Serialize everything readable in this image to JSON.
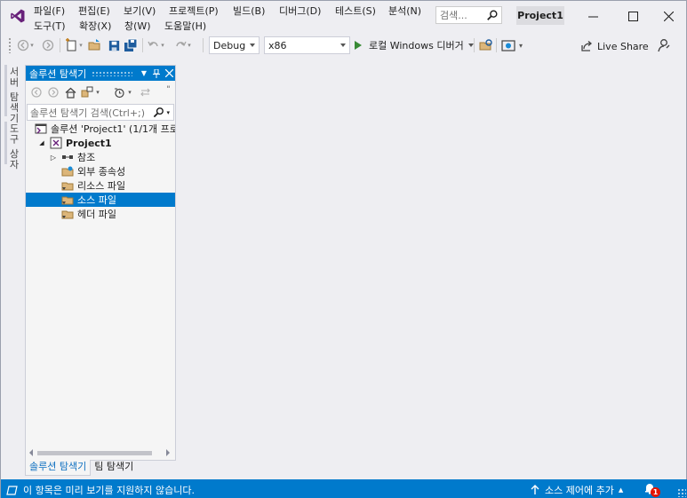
{
  "window": {
    "title": "Project1",
    "search_placeholder": "검색...",
    "controls": {
      "minimize": "—",
      "maximize": "☐",
      "close": "✕"
    }
  },
  "menu": {
    "row1": [
      "파일(F)",
      "편집(E)",
      "보기(V)",
      "프로젝트(P)",
      "빌드(B)",
      "디버그(D)",
      "테스트(S)",
      "분석(N)"
    ],
    "row2": [
      "도구(T)",
      "확장(X)",
      "창(W)",
      "도움말(H)"
    ]
  },
  "toolbar": {
    "config": "Debug",
    "platform": "x86",
    "run_label": "로컬 Windows 디버거",
    "live_share": "Live Share"
  },
  "side_tabs": [
    "서버 탐색기",
    "도구 상자"
  ],
  "solution_explorer": {
    "title": "솔루션 탐색기",
    "search_placeholder": "솔루션 탐색기 검색(Ctrl+;)",
    "tree": [
      {
        "label": "솔루션 'Project1' (1/1개 프로젝트)",
        "level": 0,
        "expander": "",
        "icon": "solution-icon",
        "bold": false,
        "selected": false
      },
      {
        "label": "Project1",
        "level": 1,
        "expander": "◢",
        "icon": "project-icon",
        "bold": true,
        "selected": false
      },
      {
        "label": "참조",
        "level": 2,
        "expander": "▷",
        "icon": "references-icon",
        "bold": false,
        "selected": false
      },
      {
        "label": "외부 종속성",
        "level": 2,
        "expander": "",
        "icon": "external-deps-icon",
        "bold": false,
        "selected": false
      },
      {
        "label": "리소스 파일",
        "level": 2,
        "expander": "",
        "icon": "folder-icon",
        "bold": false,
        "selected": false
      },
      {
        "label": "소스 파일",
        "level": 2,
        "expander": "",
        "icon": "folder-icon",
        "bold": false,
        "selected": true
      },
      {
        "label": "헤더 파일",
        "level": 2,
        "expander": "",
        "icon": "folder-icon",
        "bold": false,
        "selected": false
      }
    ]
  },
  "bottom_tabs": [
    "솔루션 탐색기",
    "팀 탐색기"
  ],
  "status": {
    "message": "이 항목은 미리 보기를 지원하지 않습니다.",
    "source_control": "소스 제어에 추가",
    "notification_count": "1"
  },
  "colors": {
    "accent": "#007acc",
    "background": "#eeeef2",
    "panel": "#f5f5f5",
    "run_green": "#388a34",
    "vs_purple": "#68217a",
    "badge_red": "#e51400"
  }
}
